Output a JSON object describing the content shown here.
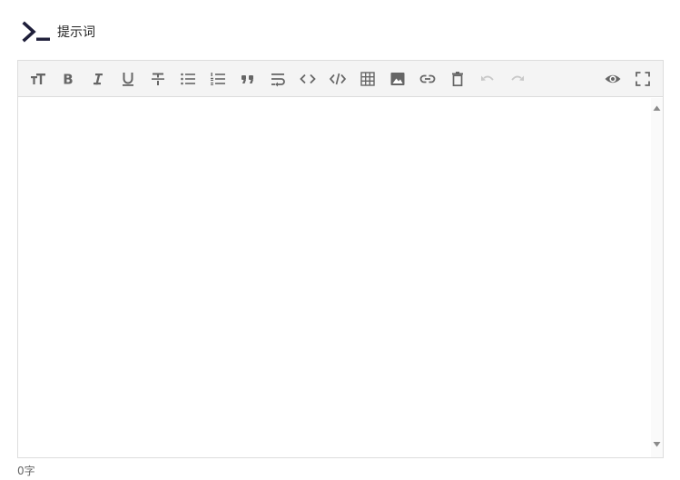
{
  "header": {
    "icon": "terminal-prompt-icon",
    "title": "提示词"
  },
  "toolbar": {
    "buttons": [
      {
        "name": "heading",
        "icon": "text-size-icon"
      },
      {
        "name": "bold",
        "icon": "bold-icon"
      },
      {
        "name": "italic",
        "icon": "italic-icon"
      },
      {
        "name": "underline",
        "icon": "underline-icon"
      },
      {
        "name": "strikethrough",
        "icon": "strikethrough-icon"
      },
      {
        "name": "unordered-list",
        "icon": "bullet-list-icon"
      },
      {
        "name": "ordered-list",
        "icon": "numbered-list-icon"
      },
      {
        "name": "blockquote",
        "icon": "quote-icon"
      },
      {
        "name": "wrap",
        "icon": "text-wrap-icon"
      },
      {
        "name": "inline-code",
        "icon": "code-icon"
      },
      {
        "name": "code-block",
        "icon": "code-block-icon"
      },
      {
        "name": "table",
        "icon": "table-icon"
      },
      {
        "name": "image",
        "icon": "image-icon"
      },
      {
        "name": "link",
        "icon": "link-icon"
      },
      {
        "name": "clear",
        "icon": "trash-icon"
      },
      {
        "name": "undo",
        "icon": "undo-icon",
        "disabled": true
      },
      {
        "name": "redo",
        "icon": "redo-icon",
        "disabled": true
      },
      {
        "name": "preview",
        "icon": "eye-icon"
      },
      {
        "name": "fullscreen",
        "icon": "fullscreen-icon"
      }
    ]
  },
  "editor": {
    "value": "",
    "placeholder": ""
  },
  "footer": {
    "char_count": "0字"
  },
  "colors": {
    "icon": "#666666",
    "icon_disabled": "#c8c8c8",
    "toolbar_bg": "#f4f4f4",
    "border": "#dddddd"
  }
}
